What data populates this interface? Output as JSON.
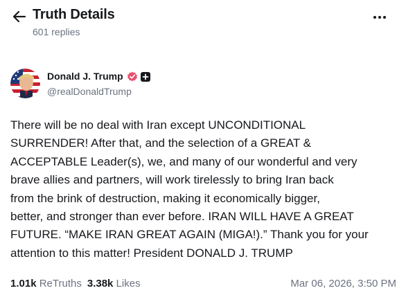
{
  "header": {
    "title": "Truth Details",
    "subtitle": "601 replies",
    "back_icon": "arrow-left-icon",
    "more_icon": "more-horizontal-icon"
  },
  "post": {
    "author_name": "Donald J. Trump",
    "handle": "@realDonaldTrump",
    "verified_icon": "verified-badge-icon",
    "verified_color": "#e8506e",
    "follow_icon": "plus-square-icon",
    "body_lines": [
      "There will be no deal with Iran except UNCONDITIONAL",
      "SURRENDER! After that, and the selection of a GREAT &",
      "ACCEPTABLE Leader(s), we, and many of our wonderful and very",
      "brave allies and partners, will work tirelessly to bring Iran back",
      "from the brink of destruction, making it economically bigger,",
      "better, and stronger than ever before. IRAN WILL HAVE A GREAT",
      "FUTURE. “MAKE IRAN GREAT AGAIN (MIGA!).” Thank you for your",
      "attention to this matter! President DONALD J. TRUMP"
    ],
    "retruths_count": "1.01k",
    "retruths_label": "ReTruths",
    "likes_count": "3.38k",
    "likes_label": "Likes",
    "timestamp": "Mar 06, 2026, 3:50 PM"
  }
}
